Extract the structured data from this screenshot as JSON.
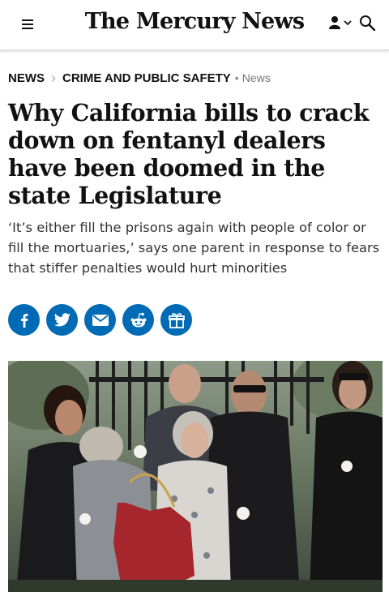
{
  "header": {
    "masthead": "The Mercury News",
    "icons": {
      "menu": "hamburger-menu-icon",
      "user": "user-icon",
      "chevron": "chevron-down-icon",
      "search": "search-icon"
    }
  },
  "breadcrumb": {
    "section": "NEWS",
    "subsection": "CRIME AND PUBLIC SAFETY",
    "tag": "News"
  },
  "article": {
    "headline": "Why California bills to crack down on fentanyl dealers have been doomed in the state Legislature",
    "dek": "‘It’s either fill the prisons again with people of color or fill the mortuaries,’ says one parent in response to fears that stiffer penalties would hurt minorities"
  },
  "share": {
    "buttons": [
      {
        "icon": "facebook-icon"
      },
      {
        "icon": "twitter-icon"
      },
      {
        "icon": "email-icon"
      },
      {
        "icon": "reddit-icon"
      },
      {
        "icon": "gift-icon"
      }
    ]
  },
  "colors": {
    "accent": "#006bb5",
    "text": "#111111",
    "muted": "#777777"
  }
}
